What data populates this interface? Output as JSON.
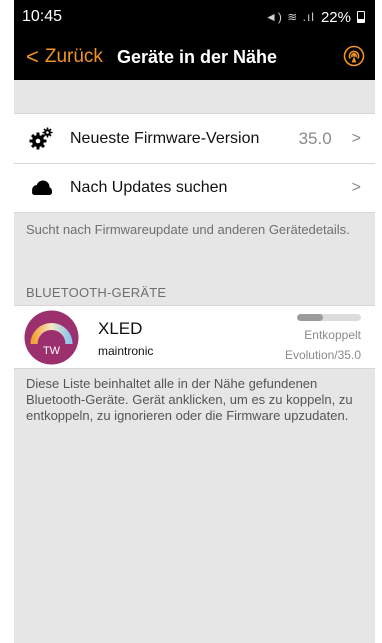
{
  "status_bar": {
    "time": "10:45",
    "icons": "◄) ≋ .ıl",
    "battery_percent": "22%"
  },
  "nav": {
    "back_label": "Zurück",
    "back_chevron": "<",
    "title": "Geräte in der Nähe",
    "action_icon": "broadcast-icon",
    "accent_color": "#f29320"
  },
  "settings": {
    "rows": [
      {
        "icon": "gears-icon",
        "label": "Neueste Firmware-Version",
        "value": "35.0",
        "chevron": ">"
      },
      {
        "icon": "cloud-icon",
        "label": "Nach Updates suchen",
        "value": "",
        "chevron": ">"
      }
    ],
    "footer": "Sucht nach Firmwareupdate und anderen Gerätedetails."
  },
  "bluetooth": {
    "header": "BLUETOOTH-GERÄTE",
    "devices": [
      {
        "name": "XLED",
        "manufacturer": "maintronic",
        "badge": "TW",
        "status": "Entkoppelt",
        "version": "Evolution/35.0",
        "signal_fraction": 0.4
      }
    ],
    "footer": "Diese Liste beinhaltet alle in der Nähe gefundenen Bluetooth-Geräte. Gerät anklicken, um es zu koppeln, zu entkoppeln, zu ignorieren oder die Firmware upzudaten."
  }
}
